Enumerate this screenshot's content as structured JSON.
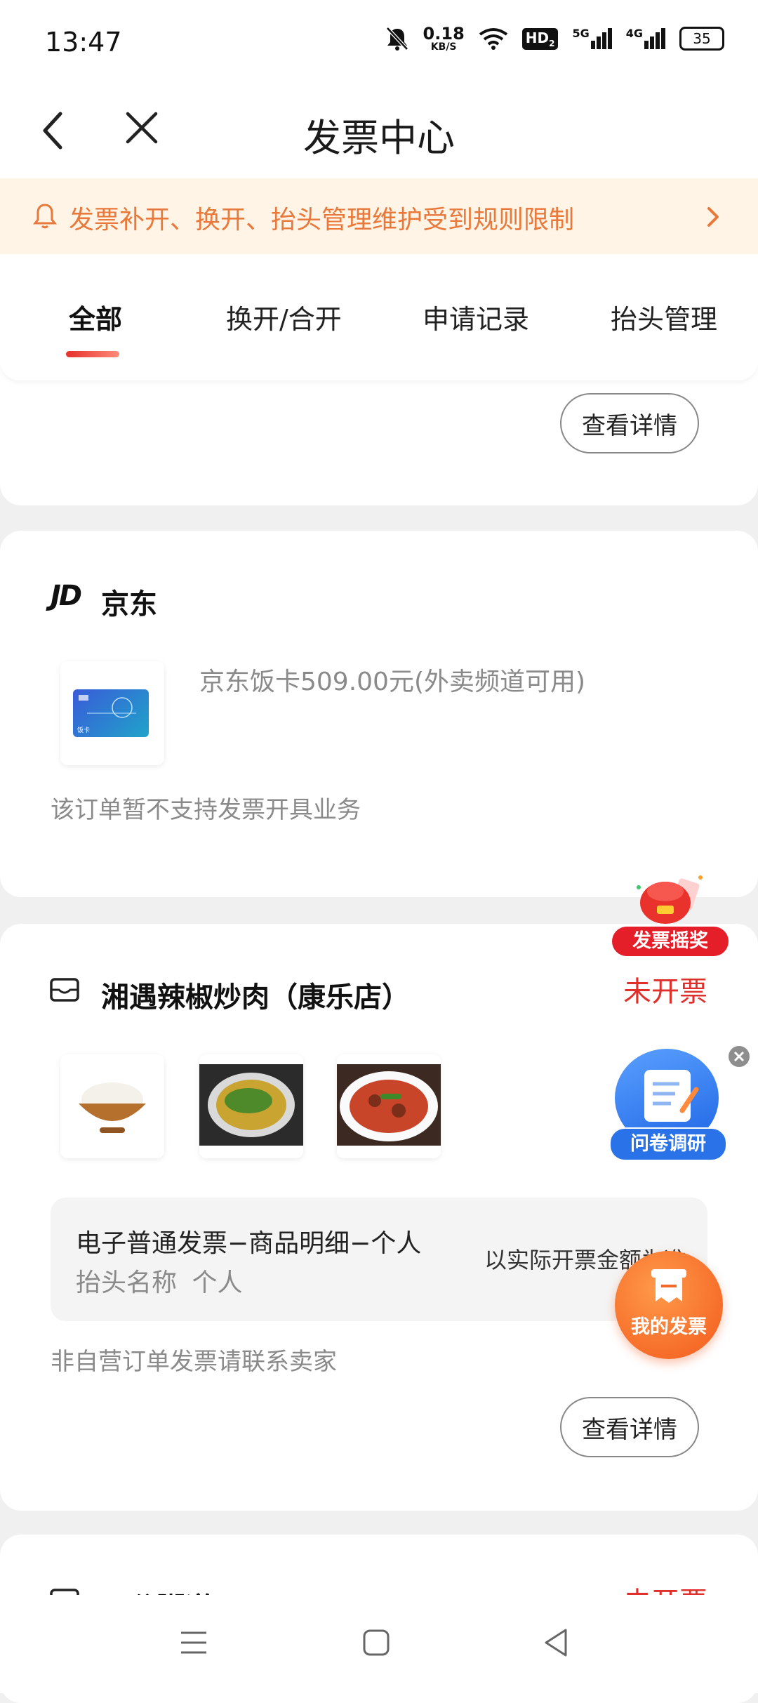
{
  "status_bar": {
    "time": "13:47",
    "net_speed_top": "0.18",
    "net_speed_unit": "KB/S",
    "hd_label": "HD",
    "hd_sub": "2",
    "signal_5g": "5G",
    "signal_4g": "4G",
    "battery": "35"
  },
  "nav": {
    "title": "发票中心"
  },
  "notice": {
    "text": "发票补开、换开、抬头管理维护受到规则限制"
  },
  "tabs": [
    {
      "label": "全部"
    },
    {
      "label": "换开/合开"
    },
    {
      "label": "申请记录"
    },
    {
      "label": "抬头管理"
    }
  ],
  "card_top": {
    "button": "查看详情"
  },
  "card_jd": {
    "store": "京东",
    "logo_text": "JD",
    "product": "京东饭卡509.00元(外卖频道可用)",
    "card_label": "饭卡",
    "note": "该订单暂不支持发票开具业务"
  },
  "card_xiang": {
    "store": "湘遇辣椒炒肉（康乐店）",
    "status": "未开票",
    "invoice_type": "电子普通发票−商品明细−个人",
    "title_label": "抬头名称",
    "title_value": "个人",
    "amount_note": "以实际开票金额为准",
    "seller_note": "非自营订单发票请联系卖家",
    "button": "查看详情"
  },
  "card_next": {
    "store": "五谷粥道",
    "status": "未开票"
  },
  "floats": {
    "lottery": "发票摇奖",
    "survey": "问卷调研",
    "my_invoice": "我的发票"
  },
  "colors": {
    "accent_red": "#e0302b",
    "notice_orange": "#e8793a",
    "notice_bg": "#fff4e6"
  }
}
